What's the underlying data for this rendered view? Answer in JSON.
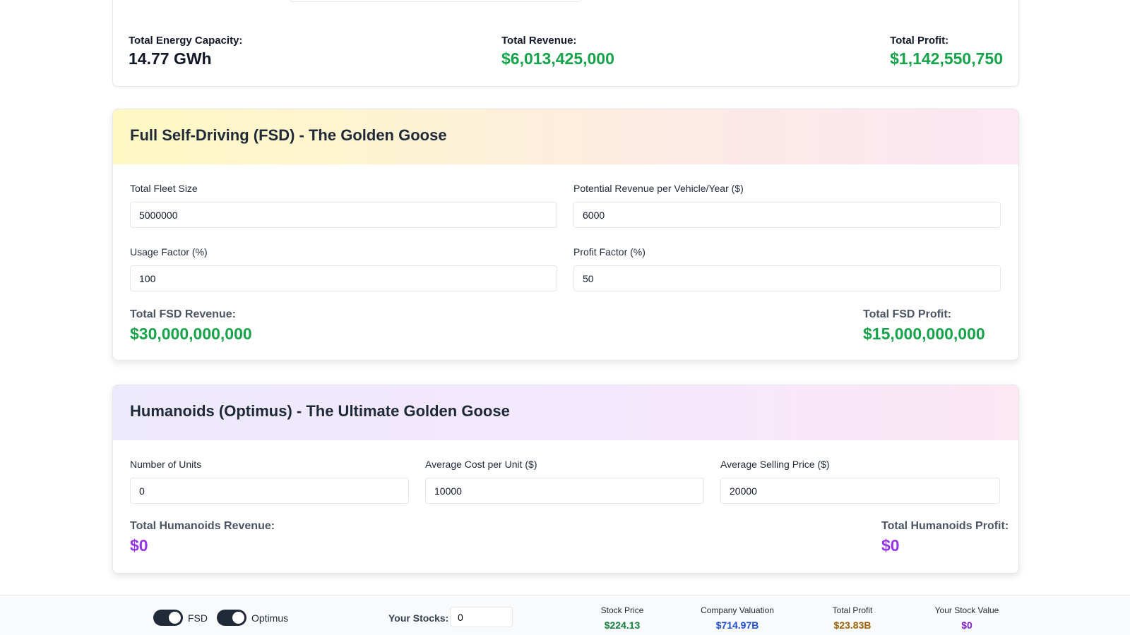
{
  "energy": {
    "capacity_label": "Total Energy Capacity:",
    "capacity_value": "14.77 GWh",
    "revenue_label": "Total Revenue:",
    "revenue_value": "$6,013,425,000",
    "profit_label": "Total Profit:",
    "profit_value": "$1,142,550,750"
  },
  "fsd": {
    "title": "Full Self-Driving (FSD) - The Golden Goose",
    "fleet_label": "Total Fleet Size",
    "fleet_value": "5000000",
    "rev_per_vehicle_label": "Potential Revenue per Vehicle/Year ($)",
    "rev_per_vehicle_value": "6000",
    "usage_label": "Usage Factor (%)",
    "usage_value": "100",
    "profit_factor_label": "Profit Factor (%)",
    "profit_factor_value": "50",
    "revenue_label": "Total FSD Revenue:",
    "revenue_value": "$30,000,000,000",
    "profit_label": "Total FSD Profit:",
    "profit_value": "$15,000,000,000"
  },
  "optimus": {
    "title": "Humanoids (Optimus) - The Ultimate Golden Goose",
    "units_label": "Number of Units",
    "units_value": "0",
    "cost_label": "Average Cost per Unit ($)",
    "cost_value": "10000",
    "price_label": "Average Selling Price ($)",
    "price_value": "20000",
    "revenue_label": "Total Humanoids Revenue:",
    "revenue_value": "$0",
    "profit_label": "Total Humanoids Profit:",
    "profit_value": "$0"
  },
  "bottom": {
    "fsd_toggle_label": "FSD",
    "optimus_toggle_label": "Optimus",
    "stocks_label": "Your Stocks:",
    "stocks_value": "0",
    "stock_price_label": "Stock Price",
    "stock_price_value": "$224.13",
    "valuation_label": "Company Valuation",
    "valuation_value": "$714.97B",
    "total_profit_label": "Total Profit",
    "total_profit_value": "$23.83B",
    "stock_value_label": "Your Stock Value",
    "stock_value_value": "$0"
  },
  "colors": {
    "green": "#16a34a",
    "purple": "#9333ea",
    "blue": "#1d4ed8",
    "amber": "#a16207"
  }
}
